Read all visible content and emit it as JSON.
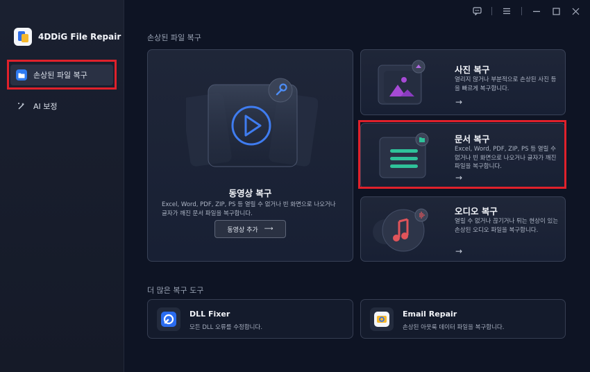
{
  "app": {
    "name": "4DDiG File Repair"
  },
  "sidebar": {
    "items": [
      {
        "label": "손상된 파일 복구",
        "icon": "folder-icon",
        "active": true
      },
      {
        "label": "AI 보정",
        "icon": "magic-wand-icon",
        "active": false
      }
    ]
  },
  "titlebar": {
    "icons": [
      "feedback-icon",
      "menu-icon",
      "minimize-icon",
      "maximize-icon",
      "close-icon"
    ]
  },
  "main": {
    "section_title": "손상된 파일 복구",
    "video": {
      "title": "동영상 복구",
      "desc": "Excel, Word, PDF, ZIP, PS 등 열릴 수 없거나 빈 화면으로 나오거나 글자가 깨진 문서 파일을 복구합니다.",
      "button": "동영상 추가",
      "arrow": "⟶"
    },
    "photo": {
      "title": "사진 복구",
      "desc": "열리지 않거나 부분적으로 손상된 사진 등을 빠르게 복구합니다.",
      "arrow": "→"
    },
    "document": {
      "title": "문서 복구",
      "desc": "Excel, Word, PDF, ZIP, PS 등 열릴 수 없거나 빈 화면으로 나오거나 글자가 깨진 파일을 복구합니다.",
      "arrow": "→"
    },
    "audio": {
      "title": "오디오 복구",
      "desc": "열릴 수 없거나 끊기거나 튀는 현상이 있는 손상된 오디오 파일을 복구합니다.",
      "arrow": "→"
    },
    "more_title": "더 많은 복구 도구",
    "tools": [
      {
        "title": "DLL Fixer",
        "desc": "모든 DLL 오류를 수정합니다."
      },
      {
        "title": "Email Repair",
        "desc": "손상된 아웃룩 데이터 파일을 복구합니다."
      }
    ]
  },
  "colors": {
    "accent": "#2f7bf2",
    "highlight": "#e0212b",
    "background": "#0e1424"
  }
}
